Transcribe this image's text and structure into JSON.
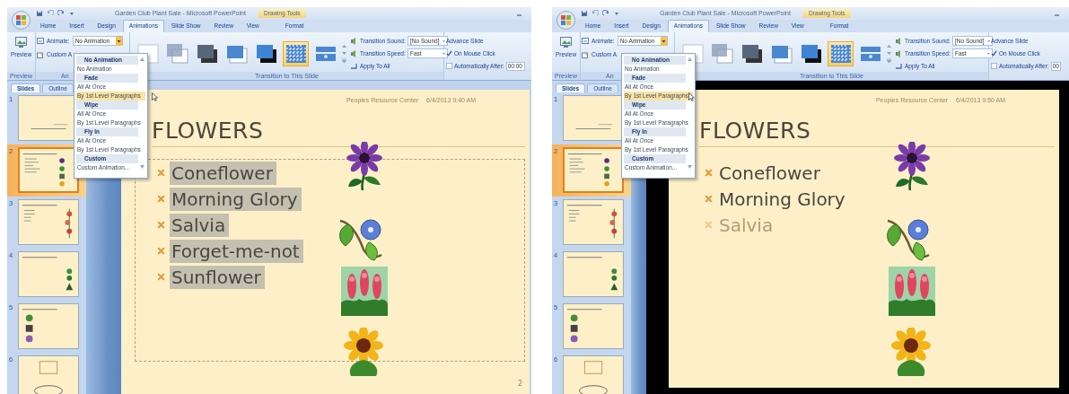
{
  "windows": [
    {
      "title": "Garden Club Plant Sale - Microsoft PowerPoint",
      "context_tab": "Drawing Tools",
      "tabs": [
        {
          "label": "Home",
          "selected": false
        },
        {
          "label": "Insert",
          "selected": false
        },
        {
          "label": "Design",
          "selected": false
        },
        {
          "label": "Animations",
          "selected": true
        },
        {
          "label": "Slide Show",
          "selected": false
        },
        {
          "label": "Review",
          "selected": false
        },
        {
          "label": "View",
          "selected": false
        },
        {
          "label": "Format",
          "selected": false
        }
      ],
      "ribbon": {
        "preview": {
          "button": "Preview",
          "group_label": "Preview"
        },
        "animations": {
          "animate_label": "Animate:",
          "animate_value": "No Animation",
          "custom_animation": "Custom A",
          "group_label": "An"
        },
        "transitions": {
          "gallery": [
            {
              "selected": false
            },
            {
              "selected": false
            },
            {
              "selected": false
            },
            {
              "selected": false
            },
            {
              "selected": false
            },
            {
              "selected": true
            },
            {
              "selected": false
            }
          ],
          "sound_label": "Transition Sound:",
          "sound_value": "[No Sound]",
          "speed_label": "Transition Speed:",
          "speed_value": "Fast",
          "apply_all": "Apply To All",
          "group_label": "Transition to This Slide"
        },
        "advance": {
          "title": "Advance Slide",
          "on_click": {
            "label": "On Mouse Click",
            "checked": true
          },
          "auto_after": {
            "label": "Automatically After:",
            "checked": false,
            "value": "00:00"
          }
        }
      },
      "pane_tabs": [
        {
          "label": "Slides",
          "selected": true
        },
        {
          "label": "Outline",
          "selected": false
        }
      ],
      "thumbnails": [
        {
          "number": "1",
          "selected": false
        },
        {
          "number": "2",
          "selected": true
        },
        {
          "number": "3",
          "selected": false
        },
        {
          "number": "4",
          "selected": false
        },
        {
          "number": "5",
          "selected": false
        },
        {
          "number": "6",
          "selected": false
        }
      ],
      "preview_mode": false,
      "slide": {
        "header": "Peoples Resource Center",
        "date": "6/4/2013 9:40 AM",
        "title": "FLOWERS",
        "text_selected": true,
        "bullets": [
          {
            "text": "Coneflower",
            "faded": false
          },
          {
            "text": "Morning Glory",
            "faded": false
          },
          {
            "text": "Salvia",
            "faded": false
          },
          {
            "text": "Forget-me-not",
            "faded": false
          },
          {
            "text": "Sunflower",
            "faded": false
          }
        ],
        "page_number": "2"
      },
      "dropdown": [
        {
          "kind": "heading",
          "label": "No Animation"
        },
        {
          "kind": "item",
          "label": "No Animation",
          "hovered": false
        },
        {
          "kind": "heading",
          "label": "Fade"
        },
        {
          "kind": "item",
          "label": "All At Once",
          "hovered": false
        },
        {
          "kind": "item",
          "label": "By 1st Level Paragraphs",
          "hovered": true
        },
        {
          "kind": "heading",
          "label": "Wipe"
        },
        {
          "kind": "item",
          "label": "All At Once",
          "hovered": false
        },
        {
          "kind": "item",
          "label": "By 1st Level Paragraphs",
          "hovered": false
        },
        {
          "kind": "heading",
          "label": "Fly In"
        },
        {
          "kind": "item",
          "label": "All At Once",
          "hovered": false
        },
        {
          "kind": "item",
          "label": "By 1st Level Paragraphs",
          "hovered": false
        },
        {
          "kind": "heading",
          "label": "Custom"
        },
        {
          "kind": "item",
          "label": "Custom Animation...",
          "hovered": false
        }
      ]
    },
    {
      "title": "Garden Club Plant Sale - Microsoft PowerPoint",
      "context_tab": "Drawing Tools",
      "tabs": [
        {
          "label": "Home",
          "selected": false
        },
        {
          "label": "Insert",
          "selected": false
        },
        {
          "label": "Design",
          "selected": false
        },
        {
          "label": "Animations",
          "selected": true
        },
        {
          "label": "Slide Show",
          "selected": false
        },
        {
          "label": "Review",
          "selected": false
        },
        {
          "label": "View",
          "selected": false
        },
        {
          "label": "Format",
          "selected": false
        }
      ],
      "ribbon": {
        "preview": {
          "button": "Preview",
          "group_label": "Preview"
        },
        "animations": {
          "animate_label": "Animate:",
          "animate_value": "No Animation",
          "custom_animation": "Custom A",
          "group_label": "An"
        },
        "transitions": {
          "gallery": [
            {
              "selected": false
            },
            {
              "selected": false
            },
            {
              "selected": false
            },
            {
              "selected": false
            },
            {
              "selected": false
            },
            {
              "selected": true
            },
            {
              "selected": false
            }
          ],
          "sound_label": "Transition Sound:",
          "sound_value": "[No Sound]",
          "speed_label": "Transition Speed:",
          "speed_value": "Fast",
          "apply_all": "Apply To All",
          "group_label": "Transition to This Slide"
        },
        "advance": {
          "title": "Advance Slide",
          "on_click": {
            "label": "On Mouse Click",
            "checked": true
          },
          "auto_after": {
            "label": "Automatically After:",
            "checked": false,
            "value": "00"
          }
        }
      },
      "pane_tabs": [
        {
          "label": "Slides",
          "selected": true
        },
        {
          "label": "Outline",
          "selected": false
        }
      ],
      "thumbnails": [
        {
          "number": "1",
          "selected": false
        },
        {
          "number": "2",
          "selected": true
        },
        {
          "number": "3",
          "selected": false
        },
        {
          "number": "4",
          "selected": false
        },
        {
          "number": "5",
          "selected": false
        },
        {
          "number": "6",
          "selected": false
        }
      ],
      "preview_mode": true,
      "slide": {
        "header": "Peoples Resource Center",
        "date": "6/4/2013 9:50 AM",
        "title": "FLOWERS",
        "text_selected": false,
        "bullets": [
          {
            "text": "Coneflower",
            "faded": false
          },
          {
            "text": "Morning Glory",
            "faded": false
          },
          {
            "text": "Salvia",
            "faded": true
          }
        ]
      },
      "dropdown": [
        {
          "kind": "heading",
          "label": "No Animation"
        },
        {
          "kind": "item",
          "label": "No Animation",
          "hovered": false
        },
        {
          "kind": "heading",
          "label": "Fade"
        },
        {
          "kind": "item",
          "label": "All At Once",
          "hovered": false
        },
        {
          "kind": "item",
          "label": "By 1st Level Paragraphs",
          "hovered": true
        },
        {
          "kind": "heading",
          "label": "Wipe"
        },
        {
          "kind": "item",
          "label": "All At Once",
          "hovered": false
        },
        {
          "kind": "item",
          "label": "By 1st Level Paragraphs",
          "hovered": false
        },
        {
          "kind": "heading",
          "label": "Fly In"
        },
        {
          "kind": "item",
          "label": "All At Once",
          "hovered": false
        },
        {
          "kind": "item",
          "label": "By 1st Level Paragraphs",
          "hovered": false
        },
        {
          "kind": "heading",
          "label": "Custom"
        },
        {
          "kind": "item",
          "label": "Custom Animation...",
          "hovered": false
        }
      ]
    }
  ]
}
